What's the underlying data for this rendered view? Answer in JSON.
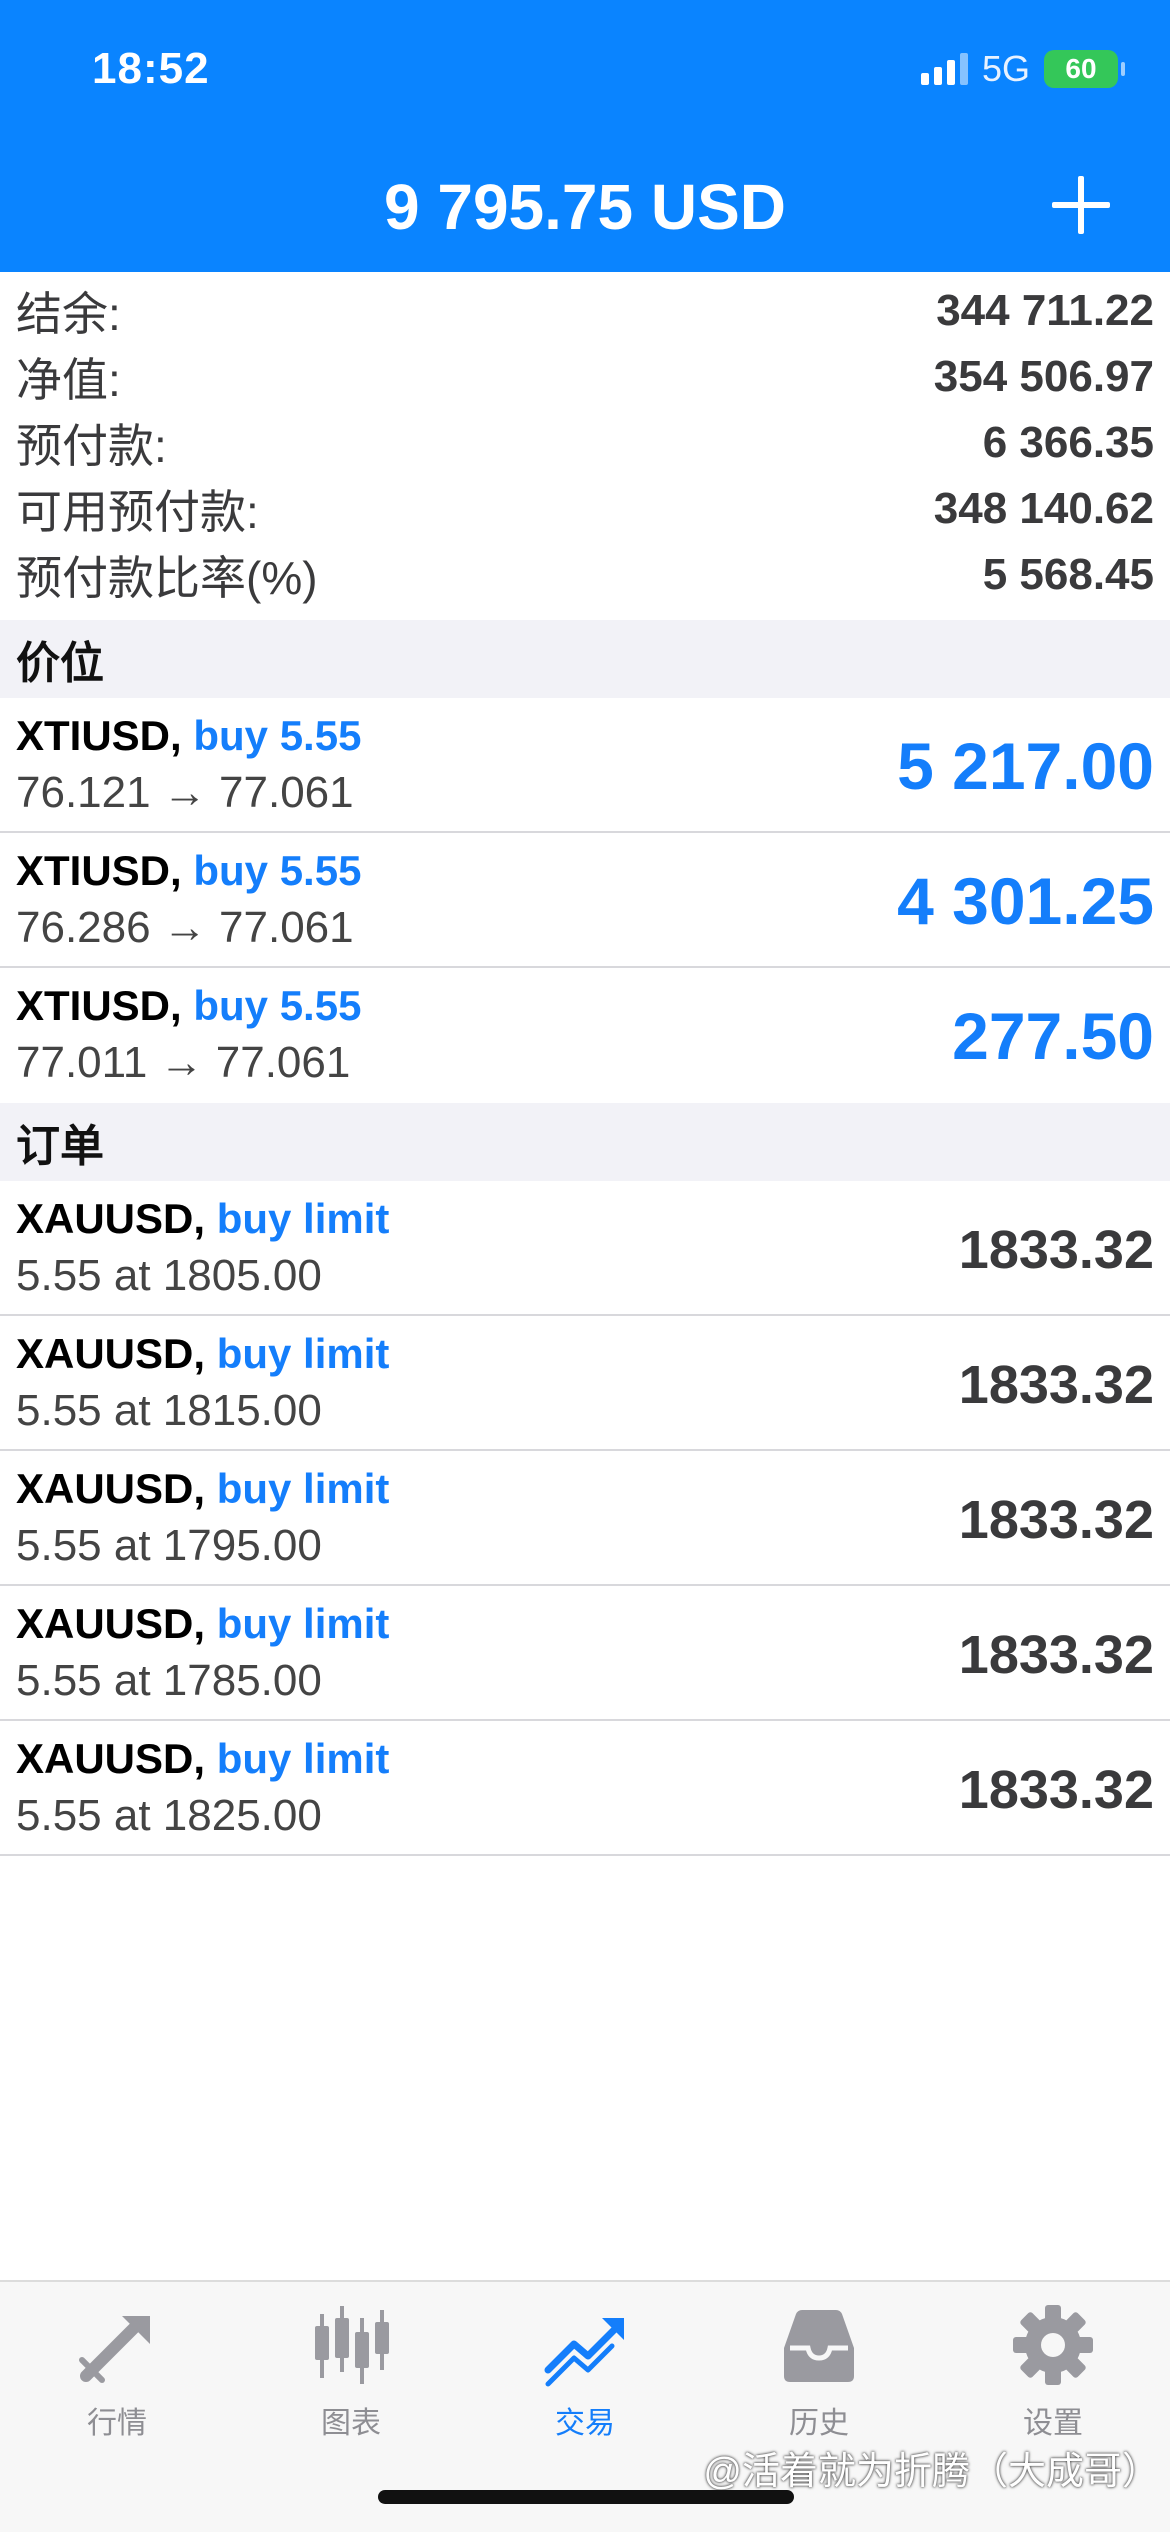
{
  "status": {
    "time": "18:52",
    "network": "5G",
    "battery": "60"
  },
  "header": {
    "title": "9 795.75 USD"
  },
  "summary": [
    {
      "label": "结余:",
      "value": "344 711.22"
    },
    {
      "label": "净值:",
      "value": "354 506.97"
    },
    {
      "label": "预付款:",
      "value": "6 366.35"
    },
    {
      "label": "可用预付款:",
      "value": "348 140.62"
    },
    {
      "label": "预付款比率(%)",
      "value": "5 568.45"
    }
  ],
  "positions_header": "价位",
  "positions": [
    {
      "symbol": "XTIUSD,",
      "action": "buy 5.55",
      "prices": "76.121 → 77.061",
      "profit": "5 217.00"
    },
    {
      "symbol": "XTIUSD,",
      "action": "buy 5.55",
      "prices": "76.286 → 77.061",
      "profit": "4 301.25"
    },
    {
      "symbol": "XTIUSD,",
      "action": "buy 5.55",
      "prices": "77.011 → 77.061",
      "profit": "277.50"
    }
  ],
  "orders_header": "订单",
  "orders": [
    {
      "symbol": "XAUUSD,",
      "action": "buy limit",
      "detail": "5.55 at 1805.00",
      "price": "1833.32"
    },
    {
      "symbol": "XAUUSD,",
      "action": "buy limit",
      "detail": "5.55 at 1815.00",
      "price": "1833.32"
    },
    {
      "symbol": "XAUUSD,",
      "action": "buy limit",
      "detail": "5.55 at 1795.00",
      "price": "1833.32"
    },
    {
      "symbol": "XAUUSD,",
      "action": "buy limit",
      "detail": "5.55 at 1785.00",
      "price": "1833.32"
    },
    {
      "symbol": "XAUUSD,",
      "action": "buy limit",
      "detail": "5.55 at 1825.00",
      "price": "1833.32"
    }
  ],
  "tabs": [
    {
      "label": "行情",
      "icon": "quotes-icon"
    },
    {
      "label": "图表",
      "icon": "candlestick-chart-icon"
    },
    {
      "label": "交易",
      "icon": "trade-icon",
      "active": true
    },
    {
      "label": "历史",
      "icon": "history-inbox-icon"
    },
    {
      "label": "设置",
      "icon": "gear-icon"
    }
  ],
  "watermark": "@活着就为折腾（大成哥）",
  "colors": {
    "header_bg": "#0a84ff",
    "accent": "#147efb",
    "battery": "#34c759"
  }
}
